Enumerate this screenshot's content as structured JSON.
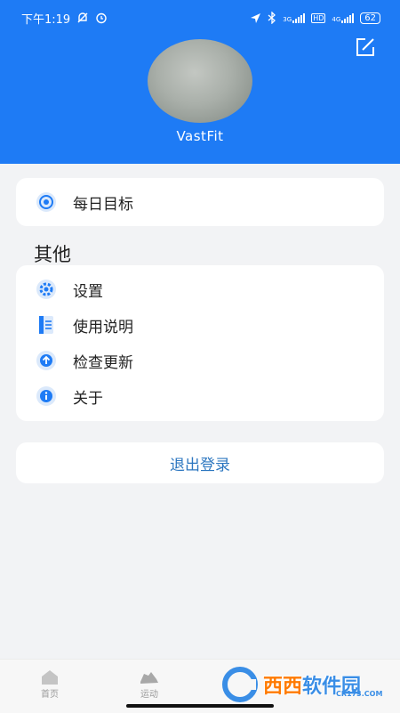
{
  "status_bar": {
    "time": "下午1:19",
    "signal_label_1": "3G",
    "hd_label": "HD",
    "signal_label_2": "4G",
    "battery": "62"
  },
  "profile": {
    "username": "VastFit"
  },
  "goals_card": {
    "items": [
      {
        "label": "每日目标",
        "icon": "target-icon"
      }
    ]
  },
  "others": {
    "title": "其他",
    "items": [
      {
        "label": "设置",
        "icon": "settings-icon"
      },
      {
        "label": "使用说明",
        "icon": "manual-icon"
      },
      {
        "label": "检查更新",
        "icon": "update-icon"
      },
      {
        "label": "关于",
        "icon": "info-icon"
      }
    ]
  },
  "logout": {
    "label": "退出登录"
  },
  "bottom_nav": {
    "items": [
      {
        "label": "首页",
        "icon": "home-icon"
      },
      {
        "label": "运动",
        "icon": "shoe-icon"
      }
    ]
  },
  "watermark": {
    "text": "西西",
    "text2": "软件园",
    "sub": "CR173.COM"
  },
  "colors": {
    "header": "#1e7bf5",
    "accent_text": "#2d77c0",
    "background": "#f2f3f5"
  }
}
